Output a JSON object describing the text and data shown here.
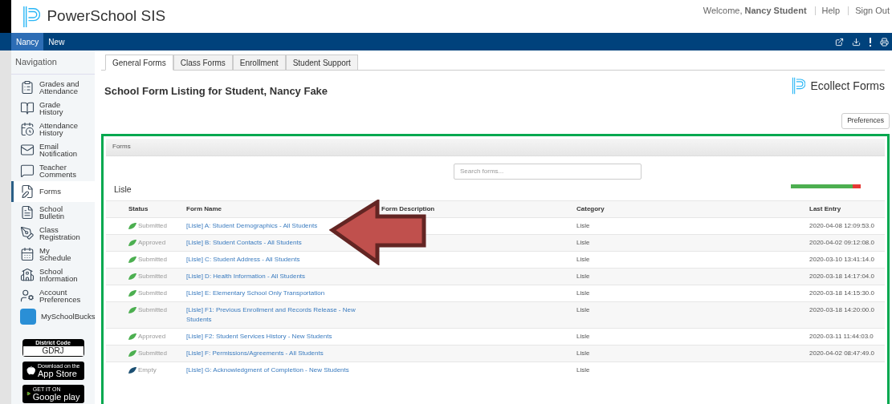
{
  "header": {
    "app_title": "PowerSchool SIS",
    "welcome": "Welcome, **Nancy Student**",
    "links": [
      "Help",
      "Sign Out"
    ]
  },
  "nav_tabs": [
    {
      "label": "Nancy",
      "selected": true
    },
    {
      "label": "New",
      "selected": false
    }
  ],
  "sidebar": {
    "title": "Navigation",
    "items": [
      {
        "label": "Grades and Attendance",
        "kind": "grades",
        "selected": false
      },
      {
        "label": "Grade History",
        "kind": "history",
        "selected": false
      },
      {
        "label": "Attendance History",
        "kind": "attendance",
        "selected": false
      },
      {
        "label": "Email Notification",
        "kind": "email",
        "selected": false
      },
      {
        "label": "Teacher Comments",
        "kind": "comments",
        "selected": false
      },
      {
        "label": "Forms",
        "kind": "forms",
        "selected": true
      },
      {
        "label": "School Bulletin",
        "kind": "bulletin",
        "selected": false
      },
      {
        "label": "Class Registration",
        "kind": "registration",
        "selected": false
      },
      {
        "label": "My Schedule",
        "kind": "schedule",
        "selected": false
      },
      {
        "label": "School Information",
        "kind": "school",
        "selected": false
      },
      {
        "label": "Account Preferences",
        "kind": "account",
        "selected": false
      },
      {
        "label": "MySchoolBucks",
        "kind": "bucks",
        "selected": false
      }
    ],
    "district_code": {
      "label": "District Code",
      "value": "GDRJ"
    },
    "app_store": {
      "small": "Download on the",
      "big": "App Store"
    },
    "google_play": {
      "small": "GET IT ON",
      "big": "Google play"
    }
  },
  "tabs": [
    {
      "label": "General Forms",
      "selected": true
    },
    {
      "label": "Class Forms",
      "selected": false
    },
    {
      "label": "Enrollment",
      "selected": false
    },
    {
      "label": "Student Support",
      "selected": false
    }
  ],
  "page_title": "School Form Listing for Student, Nancy Fake",
  "brand": "Ecollect Forms",
  "preferences_button": "Preferences",
  "panel": {
    "title": "Forms",
    "search": {
      "placeholder": "Search forms..."
    },
    "group": "Lisle",
    "progress": {
      "level": 0.88
    },
    "columns": [
      "Status",
      "Form Name",
      "Form Description",
      "Category",
      "Last Entry"
    ],
    "rows": [
      {
        "status": "Submitted",
        "color": "#4caf50",
        "name": "[Lisle] A: Student Demographics - All Students",
        "category": "Lisle",
        "last_entry": "2020-04-08 12:09:53.0"
      },
      {
        "status": "Approved",
        "color": "#4caf50",
        "name": "[Lisle] B: Student Contacts - All Students",
        "category": "Lisle",
        "last_entry": "2020-04-02 09:12:08.0"
      },
      {
        "status": "Submitted",
        "color": "#4caf50",
        "name": "[Lisle] C: Student Address - All Students",
        "category": "Lisle",
        "last_entry": "2020-03-10 13:41:14.0"
      },
      {
        "status": "Submitted",
        "color": "#4caf50",
        "name": "[Lisle] D: Health Information - All Students",
        "category": "Lisle",
        "last_entry": "2020-03-18 14:17:04.0"
      },
      {
        "status": "Submitted",
        "color": "#4caf50",
        "name": "[Lisle] E: Elementary School Only Transportation",
        "category": "Lisle",
        "last_entry": "2020-03-18 14:15:30.0"
      },
      {
        "status": "Submitted",
        "color": "#4caf50",
        "name": "[Lisle] F1: Previous Enrollment and Records Release - New Students",
        "category": "Lisle",
        "last_entry": "2020-03-18 14:20:00.0"
      },
      {
        "status": "Approved",
        "color": "#4caf50",
        "name": "[Lisle] F2: Student Services History - New Students",
        "category": "Lisle",
        "last_entry": "2020-03-11 11:44:03.0"
      },
      {
        "status": "Submitted",
        "color": "#4caf50",
        "name": "[Lisle] F: Permissions/Agreements - All Students",
        "category": "Lisle",
        "last_entry": "2020-04-02 08:47:49.0"
      },
      {
        "status": "Empty",
        "color": "#1b4f72",
        "name": "[Lisle] G: Acknowledgment of Completion - New Students",
        "category": "Lisle"
      }
    ]
  }
}
